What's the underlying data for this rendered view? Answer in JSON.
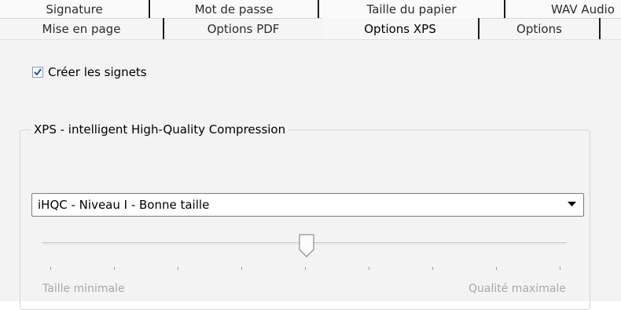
{
  "tabs": {
    "row1": [
      {
        "label": "Signature"
      },
      {
        "label": "Mot de passe"
      },
      {
        "label": "Taille du papier"
      },
      {
        "label": "WAV Audio"
      }
    ],
    "row2": [
      {
        "label": "Mise en page"
      },
      {
        "label": "Options PDF"
      },
      {
        "label": "Options XPS",
        "selected": true
      },
      {
        "label": "Options"
      }
    ]
  },
  "panel": {
    "create_bookmarks": {
      "label": "Créer les signets",
      "checked": true
    },
    "compression_group": {
      "title": "XPS - intelligent High-Quality Compression",
      "select_value": "iHQC - Niveau I - Bonne taille",
      "slider": {
        "min_label": "Taille minimale",
        "max_label": "Qualité maximale",
        "ticks": 9,
        "value_index": 4
      }
    }
  },
  "colors": {
    "check_mark": "#1e4fb5",
    "tab_separator": "#1a1a1a",
    "panel_bg": "#f3f3f3",
    "disabled_text": "#a8a8a8"
  }
}
